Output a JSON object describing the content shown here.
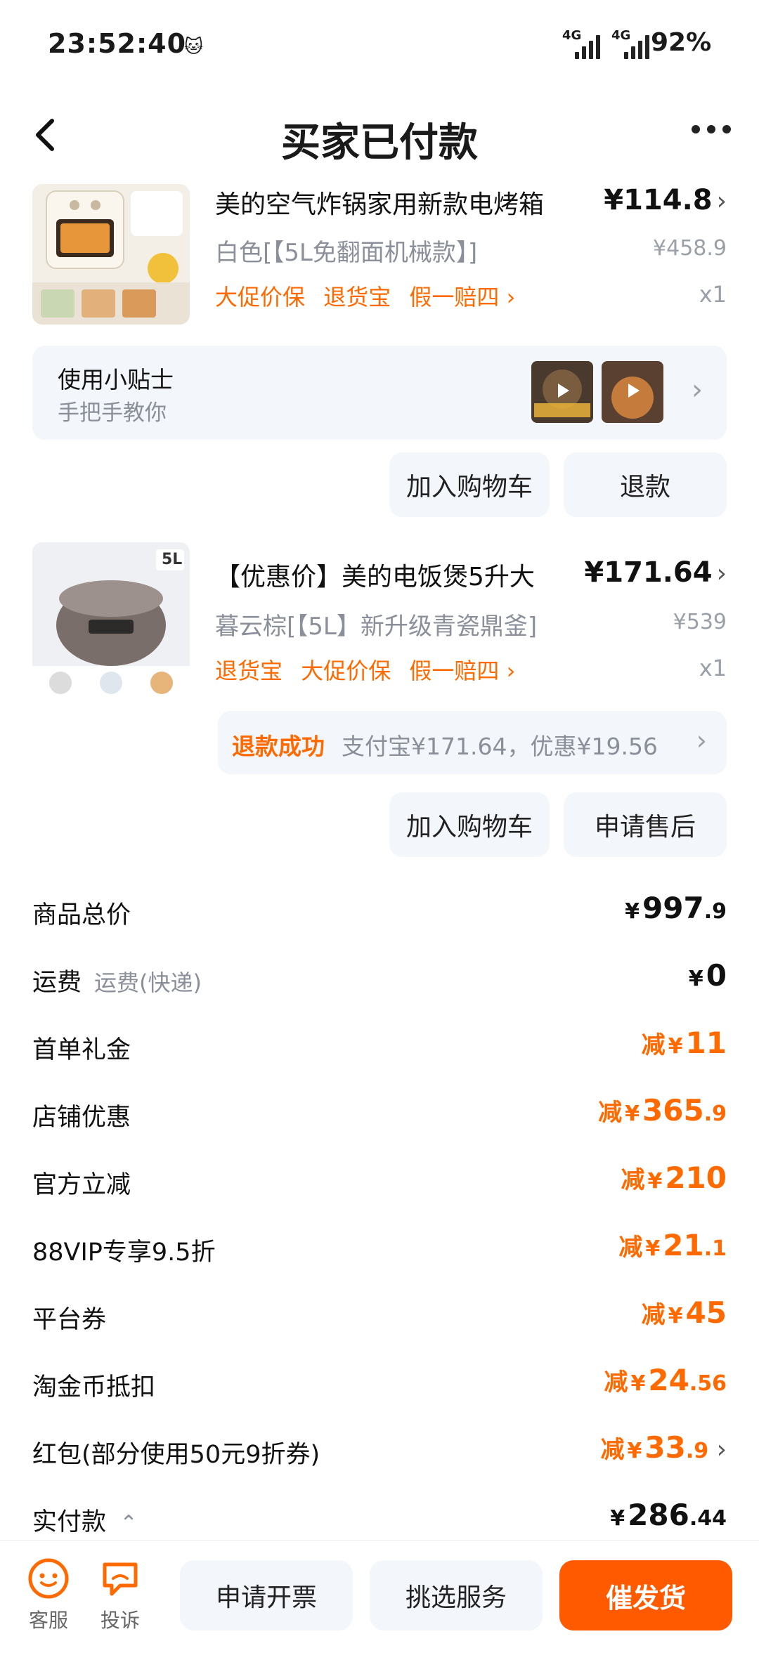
{
  "status": {
    "time": "23:52:40",
    "net1": "4G",
    "net2": "4G",
    "battery": "92%"
  },
  "nav": {
    "title": "买家已付款"
  },
  "products": [
    {
      "title": "美的空气炸锅家用新款电烤箱",
      "price": "¥114.8",
      "sku": "白色[【5L免翻面机械款】]",
      "orig_price": "¥458.9",
      "tags": [
        "大促价保",
        "退货宝",
        "假一赔四"
      ],
      "qty": "x1"
    },
    {
      "title": "【优惠价】美的电饭煲5升大",
      "price": "¥171.64",
      "sku": "暮云棕[【5L】新升级青瓷鼎釜]",
      "orig_price": "¥539",
      "tags": [
        "退货宝",
        "大促价保",
        "假一赔四"
      ],
      "qty": "x1",
      "thumb_badge": "5L"
    }
  ],
  "tips": {
    "title": "使用小贴士",
    "subtitle": "手把手教你"
  },
  "refund": {
    "status": "退款成功",
    "info": "支付宝¥171.64，优惠¥19.56"
  },
  "buttons": {
    "add_cart_1": "加入购物车",
    "refund": "退款",
    "add_cart_2": "加入购物车",
    "after_sale": "申请售后"
  },
  "costs": [
    {
      "label": "商品总价",
      "sub": "",
      "prefix": "",
      "currency": "¥",
      "int": "997",
      "dec": ".9",
      "highlight": false
    },
    {
      "label": "运费",
      "sub": "运费(快递)",
      "prefix": "",
      "currency": "¥",
      "int": "0",
      "dec": "",
      "highlight": false
    },
    {
      "label": "首单礼金",
      "sub": "",
      "prefix": "减",
      "currency": "¥",
      "int": "11",
      "dec": "",
      "highlight": true
    },
    {
      "label": "店铺优惠",
      "sub": "",
      "prefix": "减",
      "currency": "¥",
      "int": "365",
      "dec": ".9",
      "highlight": true
    },
    {
      "label": "官方立减",
      "sub": "",
      "prefix": "减",
      "currency": "¥",
      "int": "210",
      "dec": "",
      "highlight": true
    },
    {
      "label": "88VIP专享9.5折",
      "sub": "",
      "prefix": "减",
      "currency": "¥",
      "int": "21",
      "dec": ".1",
      "highlight": true
    },
    {
      "label": "平台券",
      "sub": "",
      "prefix": "减",
      "currency": "¥",
      "int": "45",
      "dec": "",
      "highlight": true
    },
    {
      "label": "淘金币抵扣",
      "sub": "",
      "prefix": "减",
      "currency": "¥",
      "int": "24",
      "dec": ".56",
      "highlight": true
    },
    {
      "label": "红包(部分使用50元9折券)",
      "sub": "",
      "prefix": "减",
      "currency": "¥",
      "int": "33",
      "dec": ".9",
      "highlight": true
    },
    {
      "label": "实付款",
      "sub": "",
      "prefix": "",
      "currency": "¥",
      "int": "286",
      "dec": ".44",
      "highlight": false
    }
  ],
  "bottom": {
    "service": "客服",
    "complain": "投诉",
    "invoice": "申请开票",
    "select_service": "挑选服务",
    "urge": "催发货"
  },
  "colors": {
    "accent": "#ff6a00",
    "primary_btn": "#ff5a00"
  }
}
